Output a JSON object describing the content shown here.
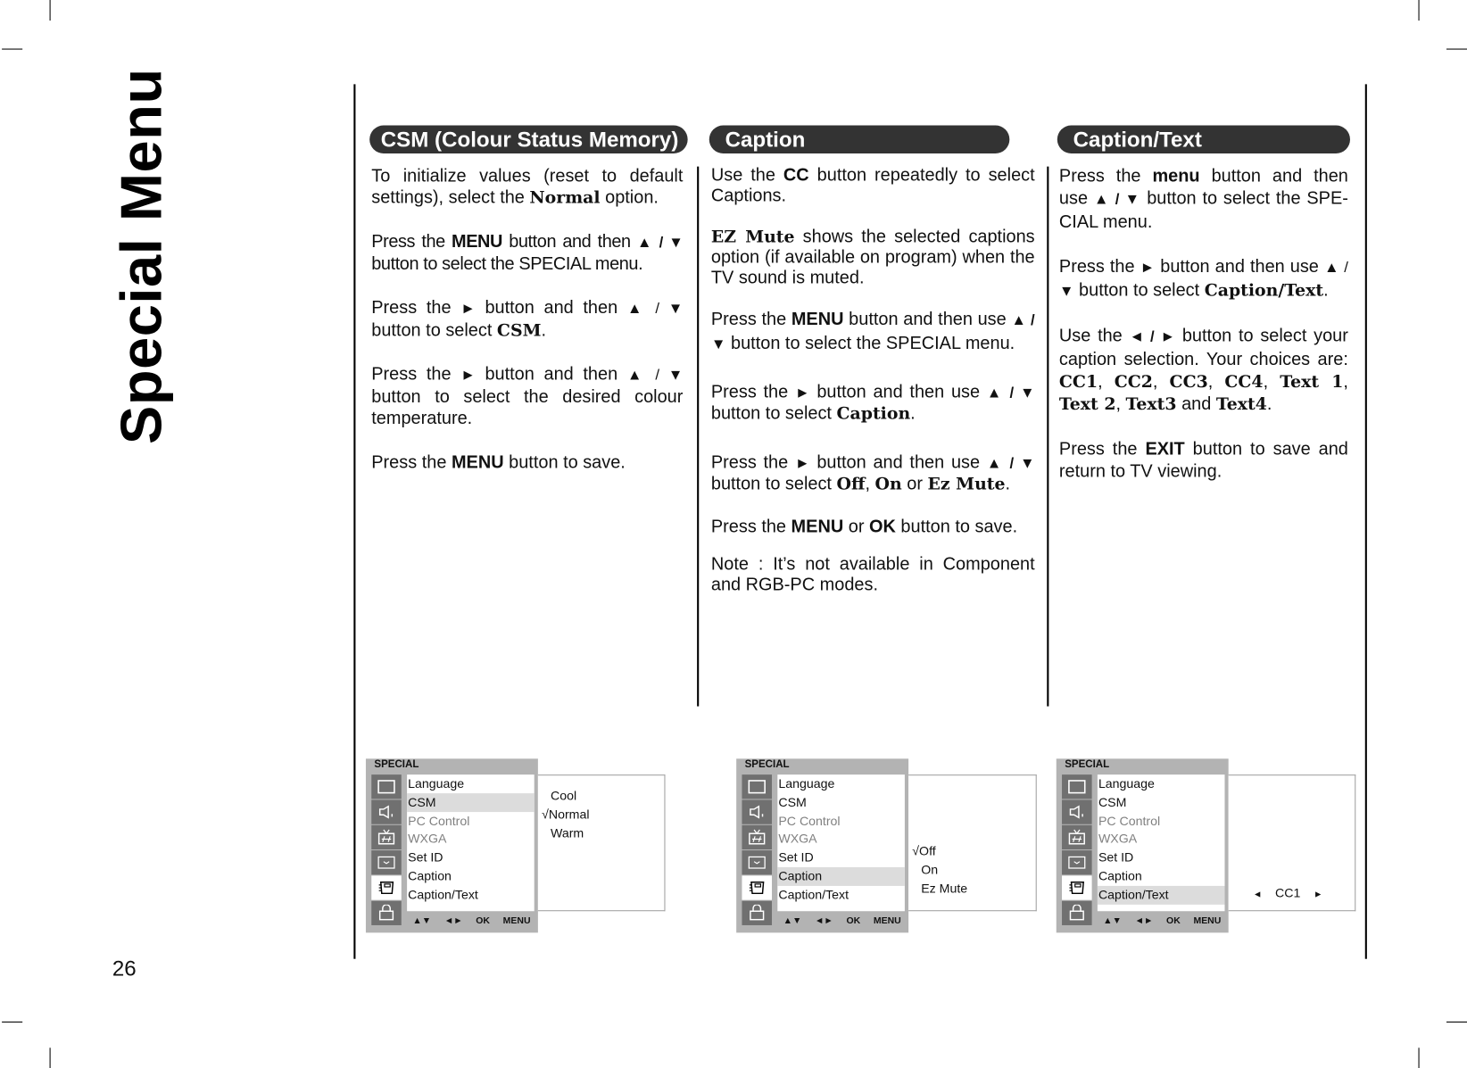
{
  "page": {
    "side_title": "Special Menu",
    "page_number": "26"
  },
  "sections": {
    "csm": {
      "title": "CSM (Colour Status Memory)",
      "p1": {
        "a": "To initialize values (reset to default settings), select the ",
        "b": "Normal",
        "c": " option."
      },
      "p2": {
        "a": "Press the ",
        "b": "MENU",
        "c": " button and then ",
        "d": "▲ / ▼",
        "e": " button to select the SPECIAL menu."
      },
      "p3": {
        "a": "Press the ",
        "arrow": "►",
        "b": "  button and then ",
        "d": "▲ / ▼",
        "e": " button to select ",
        "f": "CSM",
        "g": "."
      },
      "p4": {
        "a": "Press the ",
        "arrow": "►",
        "b": "  button and then ",
        "d": "▲ / ▼",
        "e": " button to select the desired colour temperature."
      },
      "p5": {
        "a": "Press the ",
        "b": "MENU",
        "c": " button to save."
      }
    },
    "caption": {
      "title": "Caption",
      "p1": {
        "a": "Use the ",
        "b": "CC",
        "c": " button repeatedly to select Captions."
      },
      "p2": {
        "b": "EZ Mute",
        "c": " shows the selected captions option (if available on program) when the TV sound is muted."
      },
      "p3": {
        "a": "Press the ",
        "b": "MENU",
        "c": " button and then use ",
        "d": "▲ / ▼",
        "e": " button to select the SPECIAL menu."
      },
      "p4": {
        "a": "Press the ",
        "arrow": "►",
        "b": " button and then use ",
        "d": "▲ / ▼",
        "e": " button to select ",
        "f": "Caption",
        "g": "."
      },
      "p5": {
        "a": "Press the ",
        "arrow": "►",
        "b": " button and then use ",
        "d": "▲ / ▼",
        "e": " button to select ",
        "f1": "Off",
        "s1": ", ",
        "f2": "On",
        "s2": " or ",
        "f3": "Ez Mute",
        "g": "."
      },
      "p6": {
        "a": "Press the ",
        "b": "MENU",
        "c": " or ",
        "d": "OK",
        "e": " button to save."
      },
      "p7": {
        "a": "Note : It’s not available in Component and RGB-PC modes."
      }
    },
    "caption_text": {
      "title": "Caption/Text",
      "p1": {
        "a": "Press the ",
        "b": "menu",
        "c": " button and then use ",
        "d": "▲ / ▼",
        "e": " button to select the SPE-CIAL menu."
      },
      "p2": {
        "a": "Press the ",
        "arrow": "►",
        "b": "  button and then use ",
        "d": "▲ / ▼",
        "e": " button to select ",
        "f": "Caption/Text",
        "g": "."
      },
      "p3": {
        "a": "Use the ",
        "d": "◄ / ►",
        "e": " button to select your caption selection. Your choices are: ",
        "choices": [
          "CC1",
          "CC2",
          "CC3",
          "CC4",
          "Text 1",
          "Text 2",
          "Text3"
        ],
        "and": " and ",
        "last": "Text4",
        "g": "."
      },
      "p4": {
        "a": "Press the ",
        "b": "EXIT",
        "c": " button to save and return to TV viewing."
      }
    }
  },
  "osd": {
    "header": "SPECIAL",
    "icons": [
      "picture-icon",
      "sound-icon",
      "channel-icon",
      "time-icon",
      "special-icon",
      "lock-icon"
    ],
    "items": [
      {
        "label": "Language",
        "dim": false
      },
      {
        "label": "CSM",
        "dim": false
      },
      {
        "label": "PC Control",
        "dim": true
      },
      {
        "label": "WXGA",
        "dim": true
      },
      {
        "label": "Set ID",
        "dim": false
      },
      {
        "label": "Caption",
        "dim": false
      },
      {
        "label": "Caption/Text",
        "dim": false
      }
    ],
    "footer": [
      "▲▼",
      "◄►",
      "OK",
      "MENU"
    ],
    "screens": [
      {
        "highlight": 1,
        "options": [
          {
            "label": "Cool",
            "checked": false
          },
          {
            "label": "Normal",
            "checked": true
          },
          {
            "label": "Warm",
            "checked": false
          }
        ]
      },
      {
        "highlight": 5,
        "options": [
          {
            "label": "Off",
            "checked": true
          },
          {
            "label": "On",
            "checked": false
          },
          {
            "label": "Ez Mute",
            "checked": false
          }
        ]
      },
      {
        "highlight": 6,
        "selector": {
          "left": "◄",
          "value": "CC1",
          "right": "►"
        }
      }
    ],
    "check_mark": "√"
  }
}
